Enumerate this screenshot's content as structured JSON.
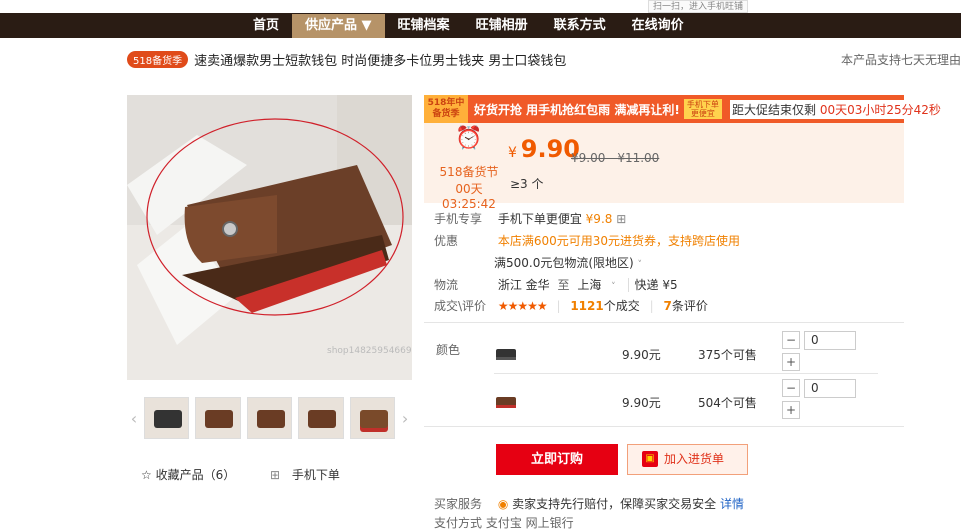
{
  "top_tip": "扫一扫，进入手机旺铺",
  "nav": [
    "首页",
    "供应产品 ▼",
    "旺铺档案",
    "旺铺相册",
    "联系方式",
    "在线询价"
  ],
  "badge": "518备货季",
  "product_title": "速卖通爆款男士短款钱包 时尚便捷多卡位男士钱夹 男士口袋钱包",
  "refund_note": "本产品支持七天无理由",
  "promo": {
    "tag": "518年中备货季",
    "text": "好货开抢 用手机抢红包雨 满减再让利!",
    "mini": "手机下单更便宜",
    "countdown_prefix": "距大促结束仅剩",
    "countdown_time": "00天03小时25分42秒"
  },
  "price": {
    "event_label": "518备货节",
    "event_time": "00天03:25:42",
    "currency": "¥",
    "current": "9.90",
    "old": "¥9.00 - ¥11.00",
    "moq": "≥3 个"
  },
  "info": {
    "mobile_label": "手机专享",
    "mobile_text": "手机下单更便宜",
    "mobile_price": "¥9.8",
    "coupon_label": "优惠",
    "coupon_text": "本店满600元可用30元进货券，支持跨店使用",
    "freight_note": "满500.0元包物流(限地区)",
    "logistics_label": "物流",
    "origin": "浙江 金华",
    "to": "至",
    "dest": "上海",
    "express": "快递 ¥5",
    "deal_label": "成交\\评价",
    "stars": "★★★★★",
    "deals_num": "1121",
    "deals_text": "个成交",
    "reviews_num": "7",
    "reviews_text": "条评价"
  },
  "sku": {
    "label": "颜色",
    "rows": [
      {
        "price": "9.90元",
        "stock": "375个可售",
        "qty": "0"
      },
      {
        "price": "9.90元",
        "stock": "504个可售",
        "qty": "0"
      }
    ]
  },
  "buttons": {
    "order": "立即订购",
    "cart": "加入进货单"
  },
  "left": {
    "fav": "收藏产品（6）",
    "mobile_order": "手机下单"
  },
  "service": {
    "label": "买家服务",
    "text": "卖家支持先行赔付，保障买家交易安全",
    "link": "详情"
  },
  "pay_row": "支付方式  支付宝  网上银行"
}
